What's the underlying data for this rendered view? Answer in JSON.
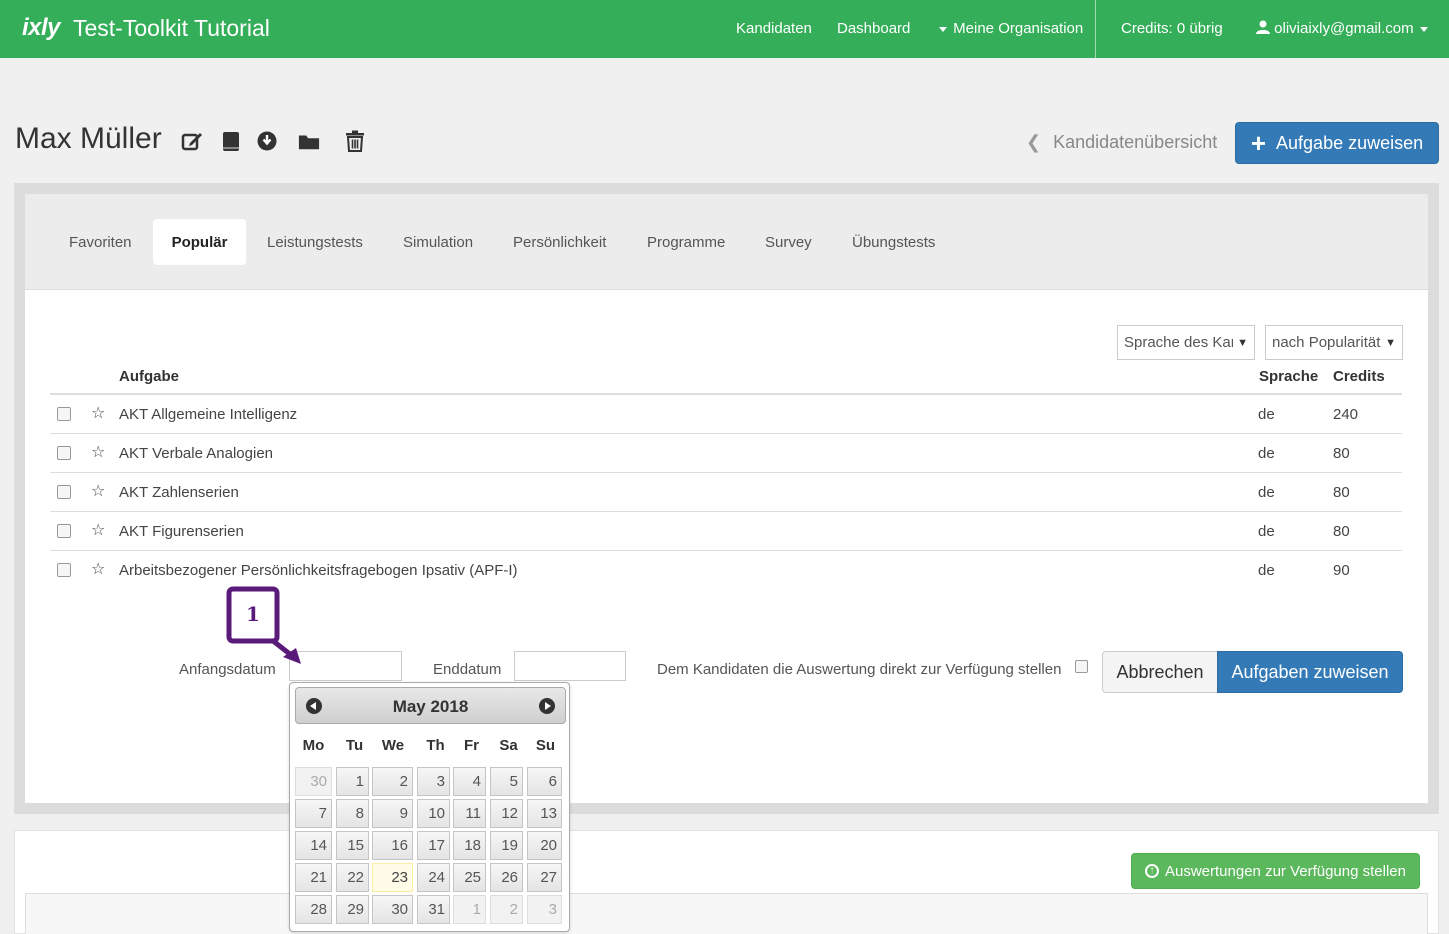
{
  "navbar": {
    "logo": "ixly",
    "title": "Test-Toolkit Tutorial",
    "links": [
      "Kandidaten",
      "Dashboard",
      "Meine Organisation"
    ],
    "credits": "Credits: 0 übrig",
    "user": "oliviaixly@gmail.com"
  },
  "header": {
    "candidate_name": "Max Müller",
    "icons": [
      "edit-icon",
      "book-icon",
      "download-icon",
      "folder-icon",
      "trash-icon"
    ],
    "back_label": "Kandidatenübersicht",
    "assign_button": "Aufgabe zuweisen"
  },
  "tabs": [
    "Favoriten",
    "Populär",
    "Leistungstests",
    "Simulation",
    "Persönlichkeit",
    "Programme",
    "Survey",
    "Übungstests"
  ],
  "active_tab": "Populär",
  "filters": {
    "language_select": "Sprache des Kandidaten",
    "sort_select": "nach Popularität"
  },
  "table": {
    "headers": {
      "task": "Aufgabe",
      "language": "Sprache",
      "credits": "Credits"
    },
    "rows": [
      {
        "name": "AKT Allgemeine Intelligenz",
        "lang": "de",
        "credits": "240"
      },
      {
        "name": "AKT Verbale Analogien",
        "lang": "de",
        "credits": "80"
      },
      {
        "name": "AKT Zahlenserien",
        "lang": "de",
        "credits": "80"
      },
      {
        "name": "AKT Figurenserien",
        "lang": "de",
        "credits": "80"
      },
      {
        "name": "Arbeitsbezogener Persönlichkeitsfragebogen Ipsativ (APF-I)",
        "lang": "de",
        "credits": "90"
      }
    ]
  },
  "form": {
    "start_label": "Anfangsdatum",
    "end_label": "Enddatum",
    "report_label": "Dem Kandidaten die Auswertung direkt zur Verfügung stellen",
    "cancel_button": "Abbrechen",
    "submit_button": "Aufgaben zuweisen"
  },
  "annotation": {
    "number": "1",
    "color": "#5a1a7a"
  },
  "lower": {
    "provide_button": "Auswertungen zur Verfügung stellen"
  },
  "datepicker": {
    "title": "May 2018",
    "weekdays": [
      "Mo",
      "Tu",
      "We",
      "Th",
      "Fr",
      "Sa",
      "Su"
    ],
    "weeks": [
      [
        "30",
        "1",
        "2",
        "3",
        "4",
        "5",
        "6"
      ],
      [
        "7",
        "8",
        "9",
        "10",
        "11",
        "12",
        "13"
      ],
      [
        "14",
        "15",
        "16",
        "17",
        "18",
        "19",
        "20"
      ],
      [
        "21",
        "22",
        "23",
        "24",
        "25",
        "26",
        "27"
      ],
      [
        "28",
        "29",
        "30",
        "31",
        "1",
        "2",
        "3"
      ]
    ],
    "today": "23"
  },
  "colors": {
    "brand_green": "#35ae5a",
    "primary": "#337ab7",
    "success": "#5cb85c"
  }
}
